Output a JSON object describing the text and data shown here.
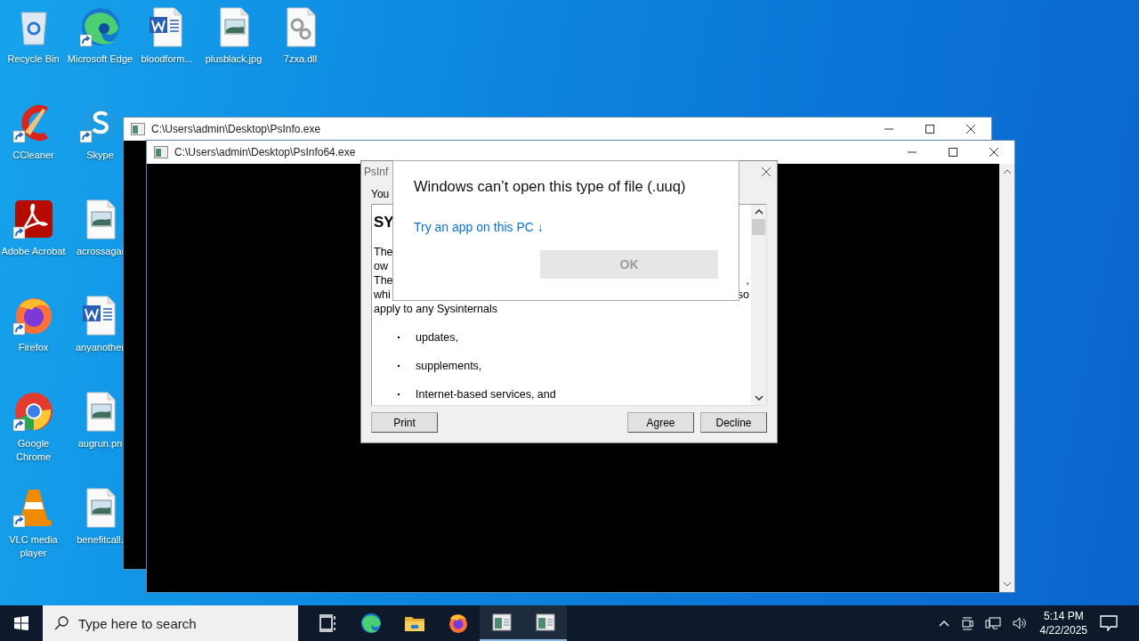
{
  "desktop": {
    "columns": [
      [
        {
          "label": "Recycle Bin",
          "kind": "recycle",
          "shortcut": false
        },
        {
          "label": "CCleaner",
          "kind": "ccleaner",
          "shortcut": true
        },
        {
          "label": "Adobe Acrobat",
          "kind": "acrobat",
          "shortcut": true
        },
        {
          "label": "Firefox",
          "kind": "firefox",
          "shortcut": true
        },
        {
          "label": "Google Chrome",
          "kind": "chrome",
          "shortcut": true
        },
        {
          "label": "VLC media player",
          "kind": "vlc",
          "shortcut": true
        }
      ],
      [
        {
          "label": "Microsoft Edge",
          "kind": "edge",
          "shortcut": true
        },
        {
          "label": "Skype",
          "kind": "skype",
          "shortcut": true
        },
        {
          "label": "acrossagai",
          "kind": "image",
          "shortcut": false
        },
        {
          "label": "anyanother",
          "kind": "word",
          "shortcut": false
        },
        {
          "label": "augrun.pn",
          "kind": "image",
          "shortcut": false
        },
        {
          "label": "benefitcall.",
          "kind": "image",
          "shortcut": false
        }
      ],
      [
        {
          "label": "bloodform...",
          "kind": "word",
          "shortcut": false
        }
      ],
      [
        {
          "label": "plusblack.jpg",
          "kind": "image",
          "shortcut": false
        }
      ],
      [
        {
          "label": "7zxa.dll",
          "kind": "dll",
          "shortcut": false
        }
      ]
    ]
  },
  "windows": [
    {
      "title": "C:\\Users\\admin\\Desktop\\PsInfo.exe",
      "kind": "console"
    },
    {
      "title": "C:\\Users\\admin\\Desktop\\PsInfo64.exe",
      "kind": "console"
    }
  ],
  "eula": {
    "title": "PsInf",
    "label": "You",
    "heading": "SY",
    "lines": [
      {
        "left": "The"
      },
      {
        "left": "ow"
      },
      {
        "left": "The",
        "right": ","
      },
      {
        "left": "whi",
        "right": "so"
      }
    ],
    "paragraph_end": "apply to any Sysinternals",
    "bullets": [
      "updates,",
      "supplements,",
      "Internet-based services, and"
    ],
    "buttons": [
      {
        "label": "Print",
        "kind": "left"
      },
      {
        "label": "Agree",
        "kind": "right"
      },
      {
        "label": "Decline",
        "kind": "right"
      }
    ]
  },
  "popup": {
    "title": "Windows can’t open this type of file (.uuq)",
    "link": "Try an app on this PC ↓",
    "ok_button": {
      "label": "OK",
      "disabled": true
    }
  },
  "taskbar": {
    "search": {
      "placeholder": "Type here to search"
    },
    "apps": [
      {
        "kind": "taskview",
        "running": false
      },
      {
        "kind": "edge",
        "running": false
      },
      {
        "kind": "folder",
        "running": false
      },
      {
        "kind": "firefox",
        "running": false
      },
      {
        "kind": "console",
        "running": true
      },
      {
        "kind": "console",
        "running": true
      }
    ],
    "clock": {
      "time": "5:14 PM",
      "date": "4/22/2025"
    }
  }
}
